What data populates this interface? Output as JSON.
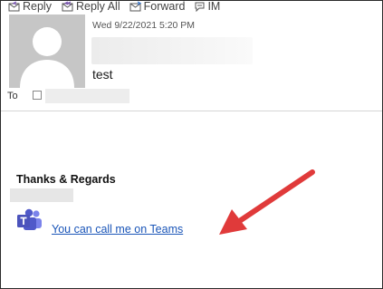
{
  "toolbar": {
    "reply_label": "Reply",
    "reply_all_label": "Reply All",
    "forward_label": "Forward",
    "im_label": "IM"
  },
  "header": {
    "date": "Wed 9/22/2021 5:20 PM",
    "subject": "test",
    "to_label": "To"
  },
  "body": {
    "signoff": "Thanks & Regards",
    "teams_link": "You can call me on Teams"
  },
  "colors": {
    "link": "#1a55b8",
    "arrow": "#e03a3a",
    "teams_purple": "#5059c9"
  },
  "icons": [
    "reply-icon",
    "reply-all-icon",
    "forward-icon",
    "im-icon",
    "teams-icon",
    "contact-checkbox"
  ]
}
